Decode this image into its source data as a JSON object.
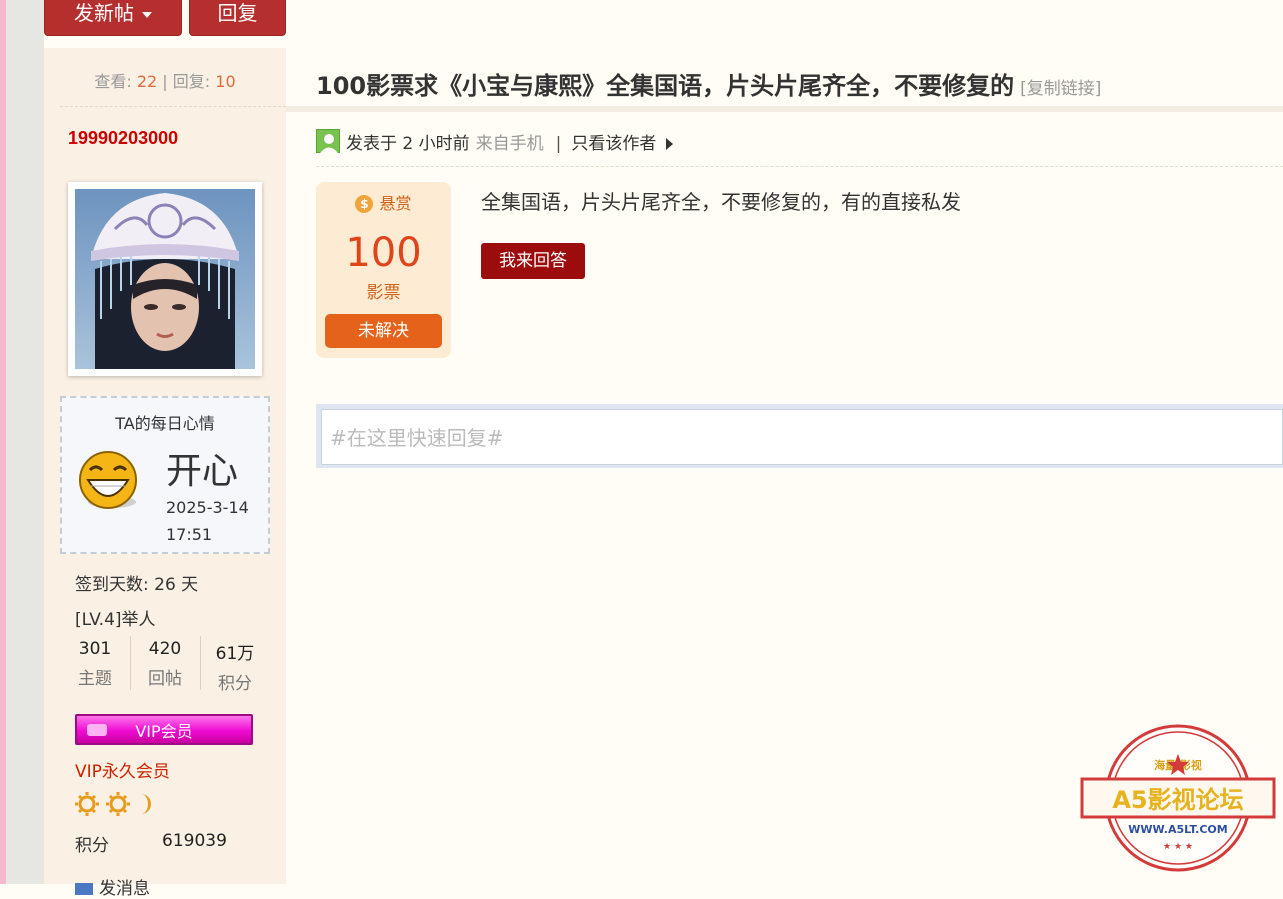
{
  "toolbar": {
    "new_post_label": "发新帖",
    "reply_label": "回复"
  },
  "thread_stats": {
    "views_label": "查看:",
    "views": "22",
    "separator": "|",
    "replies_label": "回复:",
    "replies": "10"
  },
  "author": {
    "username": "19990203000",
    "mood": {
      "title": "TA的每日心情",
      "word": "开心",
      "date": "2025-3-14",
      "time": "17:51"
    },
    "checkin": "签到天数: 26 天",
    "level": "[LV.4]举人",
    "stats": [
      {
        "value": "301",
        "label": "主题"
      },
      {
        "value": "420",
        "label": "回帖"
      },
      {
        "value": "61万",
        "label": "积分"
      }
    ],
    "vip_badge": "VIP会员",
    "vip_text": "VIP永久会员",
    "score_label": "积分",
    "score_value": "619039",
    "message_label": "发消息"
  },
  "post": {
    "title": "100影票求《小宝与康熙》全集国语，片头片尾齐全，不要修复的",
    "copy_link": "[复制链接]",
    "meta": {
      "posted": "发表于 2 小时前",
      "source": "来自手机",
      "separator": "|",
      "only_author": "只看该作者"
    },
    "reward": {
      "label": "悬赏",
      "coin": "$",
      "amount": "100",
      "unit": "影票",
      "status": "未解决"
    },
    "body": "全集国语，片头片尾齐全，不要修复的，有的直接私发",
    "answer_button": "我来回答"
  },
  "quick_reply": {
    "placeholder": "#在这里快速回复#"
  },
  "watermark": {
    "top_text": "海量 影视",
    "brand": "A5影视论坛",
    "url": "WWW.A5LT.COM"
  },
  "colors": {
    "brand_red": "#b52f2f",
    "sidebar_bg": "#faf0e3",
    "reward_orange": "#e5621a",
    "username_red": "#cc0000"
  }
}
